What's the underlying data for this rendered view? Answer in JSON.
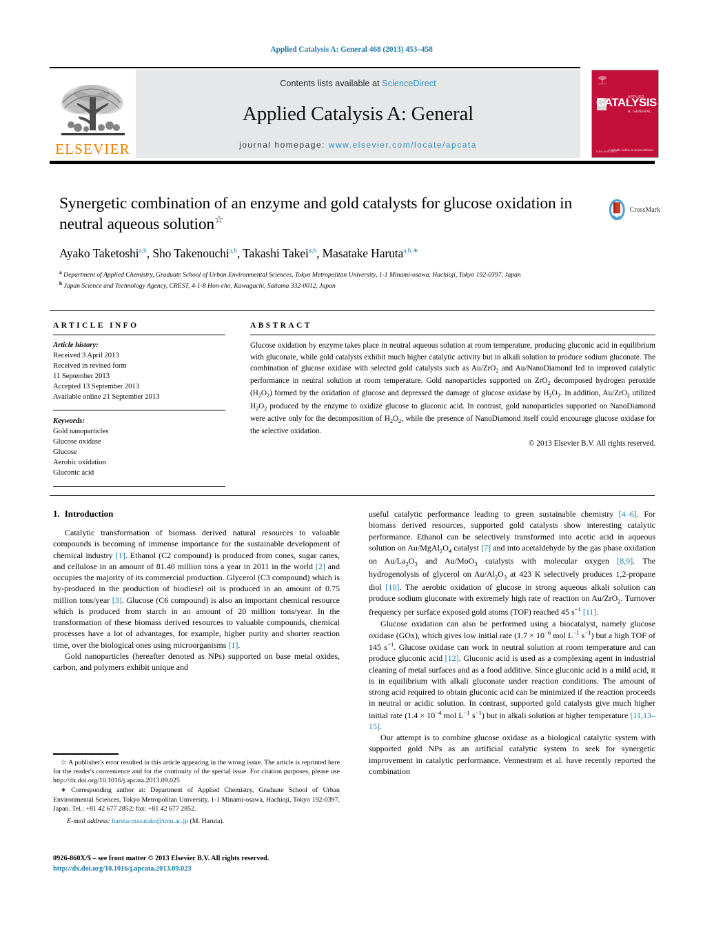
{
  "running_head": "Applied Catalysis A: General 468 (2013) 453–458",
  "masthead": {
    "contents_prefix": "Contents lists available at ",
    "sciencedirect": "ScienceDirect",
    "journal_title": "Applied Catalysis A: General",
    "homepage_prefix": "journal homepage: ",
    "homepage_url": "www.elsevier.com/locate/apcata",
    "publisher": "ELSEVIER",
    "cover_title": "CATALYSIS",
    "cover_sub_top": "APPLIED",
    "cover_sub_bottom": "A: GENERAL",
    "cover_footer_left": "ISSN 0926-860X",
    "cover_footer_right": "Available online at\nScienceDirect"
  },
  "article": {
    "title": "Synergetic combination of an enzyme and gold catalysts for glucose oxidation in neutral aqueous solution",
    "title_footnote_mark": "☆",
    "authors": [
      {
        "name": "Ayako Taketoshi",
        "marks": "a,b"
      },
      {
        "name": "Sho Takenouchi",
        "marks": "a,b"
      },
      {
        "name": "Takashi Takei",
        "marks": "a,b"
      },
      {
        "name": "Masatake Haruta",
        "marks": "a,b,∗"
      }
    ],
    "affiliations": [
      {
        "mark": "a",
        "text": "Department of Applied Chemistry, Graduate School of Urban Environmental Sciences, Tokyo Metropolitan University, 1-1 Minami-osawa, Hachioji, Tokyo 192-0397, Japan"
      },
      {
        "mark": "b",
        "text": "Japan Science and Technology Agency, CREST, 4-1-8 Hon-cho, Kawaguchi, Saitama 332-0012, Japan"
      }
    ],
    "crossmark_label": "CrossMark"
  },
  "article_info": {
    "heading": "ARTICLE INFO",
    "history_label": "Article history:",
    "history": [
      "Received 3 April 2013",
      "Received in revised form",
      "11 September 2013",
      "Accepted 13 September 2013",
      "Available online 21 September 2013"
    ],
    "keywords_label": "Keywords:",
    "keywords": [
      "Gold nanoparticles",
      "Glucose oxidase",
      "Glucose",
      "Aerobic oxidation",
      "Gluconic acid"
    ]
  },
  "abstract": {
    "heading": "ABSTRACT",
    "text": "Glucose oxidation by enzyme takes place in neutral aqueous solution at room temperature, producing gluconic acid in equilibrium with gluconate, while gold catalysts exhibit much higher catalytic activity but in alkali solution to produce sodium gluconate. The combination of glucose oxidase with selected gold catalysts such as Au/ZrO2 and Au/NanoDiamond led to improved catalytic performance in neutral solution at room temperature. Gold nanoparticles supported on ZrO2 decomposed hydrogen peroxide (H2O2) formed by the oxidation of glucose and depressed the damage of glucose oxidase by H2O2. In addition, Au/ZrO2 utilized H2O2 produced by the enzyme to oxidize glucose to gluconic acid. In contrast, gold nanoparticles supported on NanoDiamond were active only for the decomposition of H2O2, while the presence of NanoDiamond itself could encourage glucose oxidase for the selective oxidation.",
    "copyright": "© 2013 Elsevier B.V. All rights reserved."
  },
  "section": {
    "number": "1.",
    "title": "Introduction"
  },
  "footnotes": {
    "publisher_note": "☆ A publisher's error resulted in this article appearing in the wrong issue. The article is reprinted here for the reader's convenience and for the continuity of the special issue. For citation purposes, please use http://dx.doi.org/10.1016/j.apcata.2013.09.025",
    "corresponding": "∗ Corresponding author at: Department of Applied Chemistry, Graduate School of Urban Environmental Sciences, Tokyo Metropolitan University, 1-1 Minami-osawa, Hachioji, Tokyo 192-0397, Japan. Tel.: +81 42 677 2852; fax: +81 42 677 2852.",
    "email_label": "E-mail address:",
    "email": "haruta-masatake@tmu.ac.jp",
    "email_suffix": "(M. Haruta)."
  },
  "imprint": {
    "line1": "0926-860X/$ – see front matter © 2013 Elsevier B.V. All rights reserved.",
    "doi": "http://dx.doi.org/10.1016/j.apcata.2013.09.023"
  },
  "colors": {
    "link": "#1a7aa8",
    "sciencedirect": "#2a8fc4",
    "elsevier_orange": "#f08000",
    "cover_red": "#c2103a",
    "band_gray": "#e6e7e8"
  }
}
